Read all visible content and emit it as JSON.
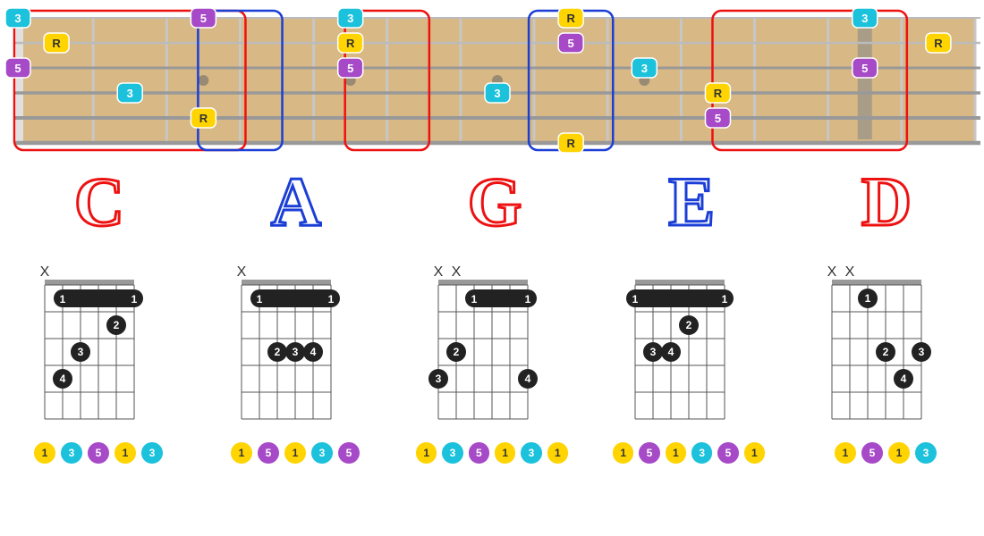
{
  "colors": {
    "root": "#ffd400",
    "third": "#1cc1dc",
    "fifth": "#a74ac7",
    "red": "#e11",
    "blue": "#1b3fd6",
    "dot": "#222"
  },
  "fretboard": {
    "strings": 6,
    "frets": 12,
    "inlay_frets": [
      3,
      5,
      7,
      9,
      12
    ],
    "shapes": [
      {
        "name": "C",
        "color": "red",
        "range": [
          0,
          3
        ]
      },
      {
        "name": "A",
        "color": "blue",
        "range": [
          2.5,
          3.5
        ]
      },
      {
        "name": "G",
        "color": "red",
        "range": [
          4.5,
          5.5
        ]
      },
      {
        "name": "E",
        "color": "blue",
        "range": [
          7,
          8
        ]
      },
      {
        "name": "D",
        "color": "red",
        "range": [
          9.5,
          12
        ]
      }
    ],
    "notes": [
      {
        "s": 1,
        "f": 0,
        "i": "3"
      },
      {
        "s": 2,
        "f": 1,
        "i": "R"
      },
      {
        "s": 3,
        "f": 0,
        "i": "5"
      },
      {
        "s": 4,
        "f": 2,
        "i": "3"
      },
      {
        "s": 1,
        "f": 3,
        "i": "5"
      },
      {
        "s": 5,
        "f": 3,
        "i": "R"
      },
      {
        "s": 1,
        "f": 5,
        "i": "3"
      },
      {
        "s": 2,
        "f": 5,
        "i": "R"
      },
      {
        "s": 3,
        "f": 5,
        "i": "5"
      },
      {
        "s": 4,
        "f": 7,
        "i": "3"
      },
      {
        "s": 1,
        "f": 8,
        "i": "R"
      },
      {
        "s": 2,
        "f": 8,
        "i": "5"
      },
      {
        "s": 6,
        "f": 8,
        "i": "R"
      },
      {
        "s": 3,
        "f": 9,
        "i": "3"
      },
      {
        "s": 4,
        "f": 10,
        "i": "R"
      },
      {
        "s": 5,
        "f": 10,
        "i": "5"
      },
      {
        "s": 1,
        "f": 12,
        "i": "3"
      },
      {
        "s": 2,
        "f": 13,
        "i": "R"
      },
      {
        "s": 3,
        "f": 12,
        "i": "5"
      }
    ]
  },
  "letters": [
    {
      "t": "C",
      "c": "red"
    },
    {
      "t": "A",
      "c": "blue"
    },
    {
      "t": "G",
      "c": "red"
    },
    {
      "t": "E",
      "c": "blue"
    },
    {
      "t": "D",
      "c": "red"
    }
  ],
  "chords": [
    {
      "name": "C",
      "mutes": [
        1
      ],
      "barre": {
        "fret": 1,
        "from": 2,
        "to": 6
      },
      "dots": [
        {
          "s": 5,
          "f": 2,
          "n": "2"
        },
        {
          "s": 3,
          "f": 3,
          "n": "3"
        },
        {
          "s": 2,
          "f": 4,
          "n": "4"
        }
      ],
      "intervals": [
        "1",
        "3",
        "5",
        "1",
        "3"
      ]
    },
    {
      "name": "A",
      "mutes": [
        1
      ],
      "barre": {
        "fret": 1,
        "from": 2,
        "to": 6
      },
      "dots": [
        {
          "s": 3,
          "f": 3,
          "n": "2"
        },
        {
          "s": 4,
          "f": 3,
          "n": "3"
        },
        {
          "s": 5,
          "f": 3,
          "n": "4"
        }
      ],
      "intervals": [
        "1",
        "5",
        "1",
        "3",
        "5"
      ]
    },
    {
      "name": "G",
      "mutes": [
        1,
        2
      ],
      "barre": {
        "fret": 1,
        "from": 3,
        "to": 6
      },
      "dots": [
        {
          "s": 2,
          "f": 3,
          "n": "2"
        },
        {
          "s": 1,
          "f": 4,
          "n": "3"
        },
        {
          "s": 6,
          "f": 4,
          "n": "4"
        }
      ],
      "intervals": [
        "1",
        "3",
        "5",
        "1",
        "3",
        "1"
      ]
    },
    {
      "name": "E",
      "mutes": [],
      "barre": {
        "fret": 1,
        "from": 1,
        "to": 6
      },
      "dots": [
        {
          "s": 4,
          "f": 2,
          "n": "2"
        },
        {
          "s": 2,
          "f": 3,
          "n": "3"
        },
        {
          "s": 3,
          "f": 3,
          "n": "4"
        }
      ],
      "intervals": [
        "1",
        "5",
        "1",
        "3",
        "5",
        "1"
      ]
    },
    {
      "name": "D",
      "mutes": [
        1,
        2
      ],
      "dots": [
        {
          "s": 3,
          "f": 1,
          "n": "1"
        },
        {
          "s": 4,
          "f": 3,
          "n": "2"
        },
        {
          "s": 6,
          "f": 3,
          "n": "3"
        },
        {
          "s": 5,
          "f": 4,
          "n": "4"
        }
      ],
      "intervals": [
        "1",
        "5",
        "1",
        "3"
      ]
    }
  ]
}
